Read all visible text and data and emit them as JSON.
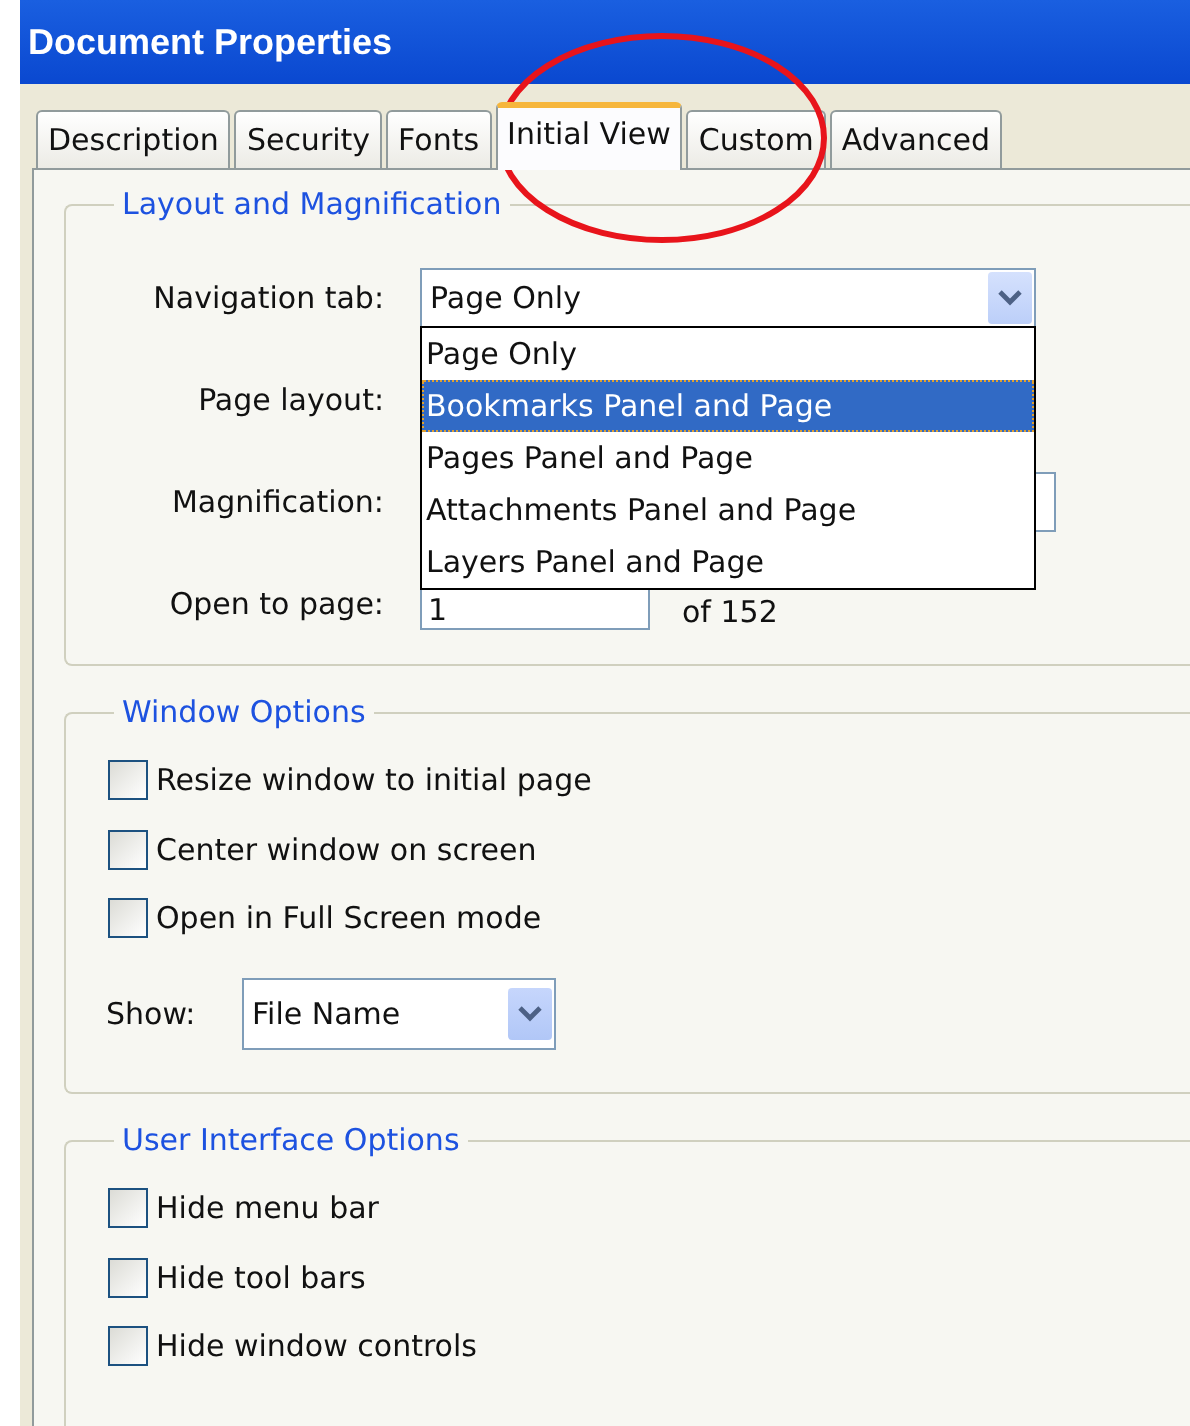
{
  "window": {
    "title": "Document Properties"
  },
  "tabs": [
    {
      "label": "Description",
      "selected": false
    },
    {
      "label": "Security",
      "selected": false
    },
    {
      "label": "Fonts",
      "selected": false
    },
    {
      "label": "Initial View",
      "selected": true
    },
    {
      "label": "Custom",
      "selected": false
    },
    {
      "label": "Advanced",
      "selected": false
    }
  ],
  "layout_group": {
    "title": "Layout and Magnification",
    "navigation_tab": {
      "label": "Navigation tab:",
      "value": "Page Only",
      "expanded": true,
      "options": [
        {
          "label": "Page Only",
          "highlighted": false
        },
        {
          "label": "Bookmarks Panel and Page",
          "highlighted": true
        },
        {
          "label": "Pages Panel and Page",
          "highlighted": false
        },
        {
          "label": "Attachments Panel and Page",
          "highlighted": false
        },
        {
          "label": "Layers Panel and Page",
          "highlighted": false
        }
      ]
    },
    "page_layout": {
      "label": "Page layout:"
    },
    "magnification": {
      "label": "Magnification:"
    },
    "open_to_page": {
      "label": "Open to page:",
      "value": "1",
      "of": "of 152"
    }
  },
  "window_group": {
    "title": "Window Options",
    "checkboxes": [
      {
        "label": "Resize window to initial page",
        "checked": false
      },
      {
        "label": "Center window on screen",
        "checked": false
      },
      {
        "label": "Open in Full Screen mode",
        "checked": false
      }
    ],
    "show": {
      "label": "Show:",
      "value": "File Name"
    }
  },
  "ui_group": {
    "title": "User Interface Options",
    "checkboxes": [
      {
        "label": "Hide menu bar",
        "checked": false
      },
      {
        "label": "Hide tool bars",
        "checked": false
      },
      {
        "label": "Hide window controls",
        "checked": false
      }
    ]
  }
}
